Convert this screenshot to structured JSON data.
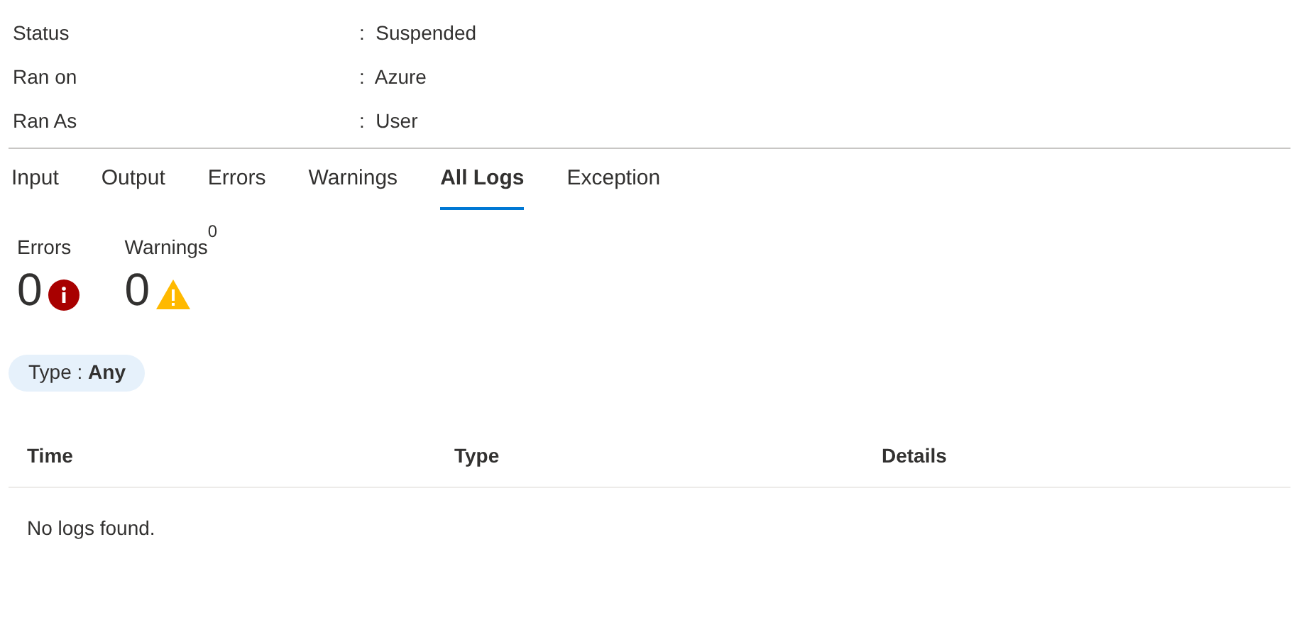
{
  "properties": [
    {
      "label": "Status",
      "value": ":  Suspended"
    },
    {
      "label": "Ran on",
      "value": ":  Azure"
    },
    {
      "label": "Ran As",
      "value": ":  User"
    }
  ],
  "tabs": [
    {
      "label": "Input",
      "selected": false
    },
    {
      "label": "Output",
      "selected": false
    },
    {
      "label": "Errors",
      "selected": false
    },
    {
      "label": "Warnings",
      "selected": false
    },
    {
      "label": "All Logs",
      "selected": true
    },
    {
      "label": "Exception",
      "selected": false
    }
  ],
  "summary": [
    {
      "kind": "error",
      "label": "Errors",
      "count": "0"
    },
    {
      "kind": "warning",
      "label": "Warnings",
      "superscript": "0",
      "count": "0"
    }
  ],
  "filter": {
    "text": "Type : **Any**"
  },
  "table": {
    "columns": [
      "Time",
      "Type",
      "Details"
    ],
    "empty_message": "No logs found."
  }
}
